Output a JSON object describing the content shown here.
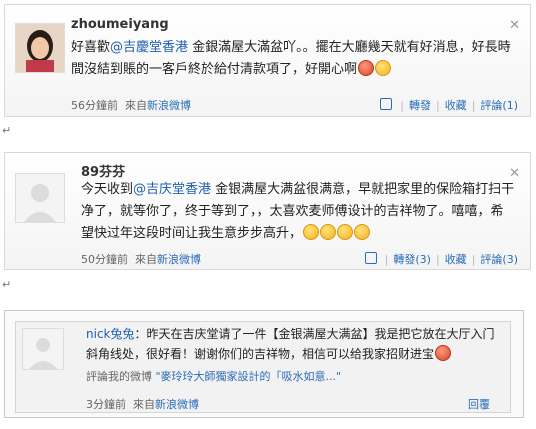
{
  "posts": [
    {
      "username": "zhoumeiyang",
      "body_pre": "好喜歡",
      "mention": "@吉慶堂香港",
      "body_post": " 金銀滿屋大滿盆吖。。擺在大廳幾天就有好消息，好長時間沒結到賬的一客戶終於給付清款項了，好開心啊",
      "time": "56分鐘前",
      "from_label": "來自",
      "source": "新浪微博",
      "like": "",
      "repost": "轉發",
      "fav": "收藏",
      "comment": "評論(1)",
      "close": "✕"
    },
    {
      "username": "89芬芬",
      "body_pre": "今天收到",
      "mention": "@吉庆堂香港",
      "body_post": " 金银满屋大满盆很满意，早就把家里的保险箱打扫干净了，就等你了，终于等到了，，太喜欢麦师傅设计的吉祥物了。嘻嘻，希望快过年这段时间让我生意步步高升，",
      "time": "50分鐘前",
      "from_label": "來自",
      "source": "新浪微博",
      "like": "",
      "repost": "轉發(3)",
      "fav": "收藏",
      "comment": "評論(3)",
      "close": "✕"
    },
    {
      "username": "nick兔兔",
      "body": "：昨天在吉庆堂请了一件【金银满屋大满盆】我是把它放在大厅入门斜角线处，很好看！谢谢你们的吉祥物，相信可以给我家招财进宝",
      "comment_on_label": "評論我的微博",
      "comment_on_quote": "\"麥玲玲大師獨家設計的「吸水如意...\"",
      "time": "3分鐘前",
      "from_label": "來自",
      "source": "新浪微博",
      "reply": "回覆"
    }
  ],
  "pilcrow": "↵"
}
